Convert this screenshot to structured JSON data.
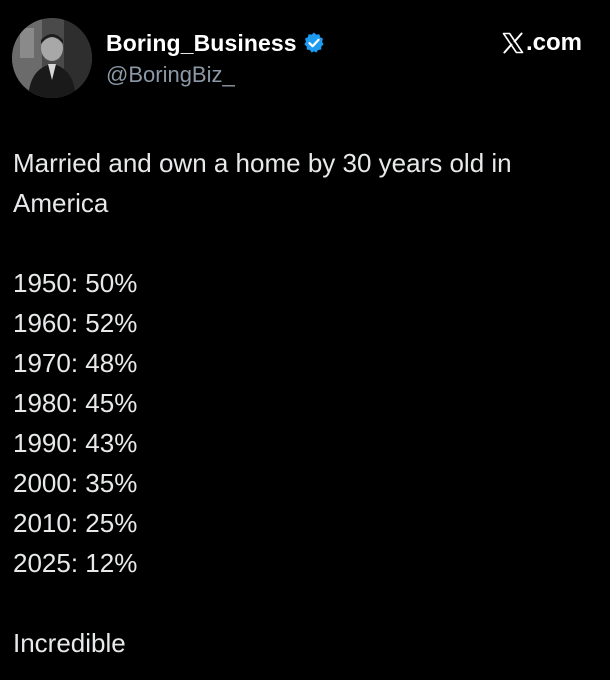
{
  "author": {
    "display_name": "Boring_Business",
    "handle": "@BoringBiz_",
    "verified": true,
    "avatar_icon": "portrait-photo",
    "verified_color": "#1d9bf0"
  },
  "brand": {
    "icon": "x-logo-icon",
    "domain": ".com"
  },
  "tweet": {
    "headline": "Married and own a home by 30 years old in America",
    "stats": [
      {
        "text": "1950: 50%"
      },
      {
        "text": "1960: 52%"
      },
      {
        "text": "1970: 48%"
      },
      {
        "text": "1980: 45%"
      },
      {
        "text": "1990: 43%"
      },
      {
        "text": "2000: 35%"
      },
      {
        "text": "2010: 25%"
      },
      {
        "text": "2025: 12%"
      }
    ],
    "closing": "Incredible"
  },
  "colors": {
    "background": "#000000",
    "text": "#e7e9ea",
    "secondary_text": "#8b98a5"
  }
}
